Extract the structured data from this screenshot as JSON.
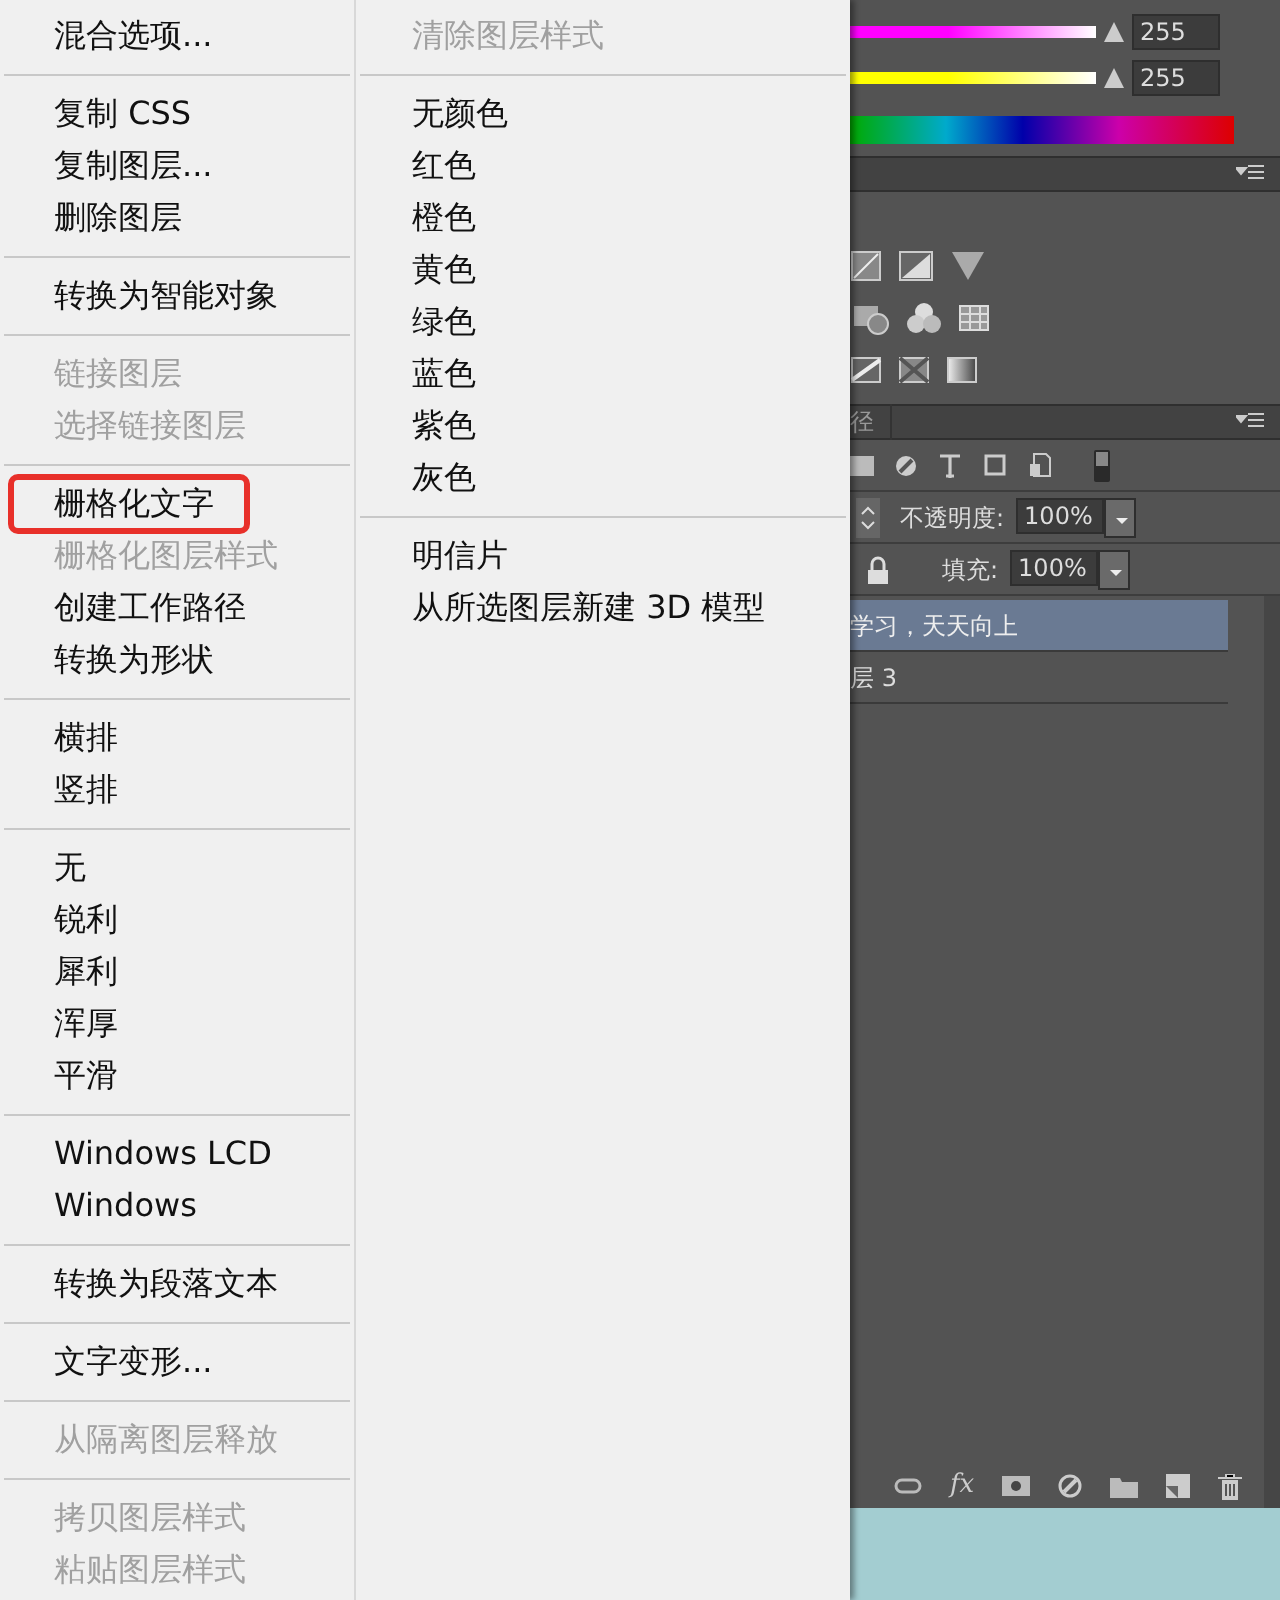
{
  "context_menu": {
    "left_groups": [
      [
        {
          "label": "混合选项...",
          "disabled": false,
          "outlined": false
        }
      ],
      [
        {
          "label": "复制 CSS",
          "disabled": false,
          "outlined": false
        },
        {
          "label": "复制图层...",
          "disabled": false,
          "outlined": false
        },
        {
          "label": "删除图层",
          "disabled": false,
          "outlined": false
        }
      ],
      [
        {
          "label": "转换为智能对象",
          "disabled": false,
          "outlined": false
        }
      ],
      [
        {
          "label": "链接图层",
          "disabled": true,
          "outlined": false
        },
        {
          "label": "选择链接图层",
          "disabled": true,
          "outlined": false
        }
      ],
      [
        {
          "label": "栅格化文字",
          "disabled": false,
          "outlined": true
        },
        {
          "label": "栅格化图层样式",
          "disabled": true,
          "outlined": false
        },
        {
          "label": "创建工作路径",
          "disabled": false,
          "outlined": false
        },
        {
          "label": "转换为形状",
          "disabled": false,
          "outlined": false
        }
      ],
      [
        {
          "label": "横排",
          "disabled": false,
          "outlined": false
        },
        {
          "label": "竖排",
          "disabled": false,
          "outlined": false
        }
      ],
      [
        {
          "label": "无",
          "disabled": false,
          "outlined": false
        },
        {
          "label": "锐利",
          "disabled": false,
          "outlined": false
        },
        {
          "label": "犀利",
          "disabled": false,
          "outlined": false
        },
        {
          "label": "浑厚",
          "disabled": false,
          "outlined": false
        },
        {
          "label": "平滑",
          "disabled": false,
          "outlined": false
        }
      ],
      [
        {
          "label": "Windows LCD",
          "disabled": false,
          "outlined": false
        },
        {
          "label": "Windows",
          "disabled": false,
          "outlined": false
        }
      ],
      [
        {
          "label": "转换为段落文本",
          "disabled": false,
          "outlined": false
        }
      ],
      [
        {
          "label": "文字变形...",
          "disabled": false,
          "outlined": false
        }
      ],
      [
        {
          "label": "从隔离图层释放",
          "disabled": true,
          "outlined": false
        }
      ],
      [
        {
          "label": "拷贝图层样式",
          "disabled": true,
          "outlined": false
        },
        {
          "label": "粘贴图层样式",
          "disabled": true,
          "outlined": false
        }
      ]
    ],
    "right_groups": [
      [
        {
          "label": "清除图层样式",
          "disabled": true,
          "outlined": false
        }
      ],
      [
        {
          "label": "无颜色",
          "disabled": false,
          "outlined": false
        },
        {
          "label": "红色",
          "disabled": false,
          "outlined": false
        },
        {
          "label": "橙色",
          "disabled": false,
          "outlined": false
        },
        {
          "label": "黄色",
          "disabled": false,
          "outlined": false
        },
        {
          "label": "绿色",
          "disabled": false,
          "outlined": false
        },
        {
          "label": "蓝色",
          "disabled": false,
          "outlined": false
        },
        {
          "label": "紫色",
          "disabled": false,
          "outlined": false
        },
        {
          "label": "灰色",
          "disabled": false,
          "outlined": false
        }
      ],
      [
        {
          "label": "明信片",
          "disabled": false,
          "outlined": false
        },
        {
          "label": "从所选图层新建 3D 模型",
          "disabled": false,
          "outlined": false
        }
      ]
    ]
  },
  "color_panel": {
    "sliders": [
      {
        "color": "#ff00ff",
        "level": 1,
        "value": "255"
      },
      {
        "color": "#ffff00",
        "level": 1,
        "value": "255"
      }
    ]
  },
  "layers_panel": {
    "tab": "径",
    "opacity_label": "不透明度:",
    "opacity_value": "100%",
    "fill_label": "填充:",
    "fill_value": "100%",
    "fx_label": "fx",
    "layers": [
      {
        "name": "学习，天天向上",
        "selected": true
      },
      {
        "name": "层 3",
        "selected": false
      }
    ]
  }
}
